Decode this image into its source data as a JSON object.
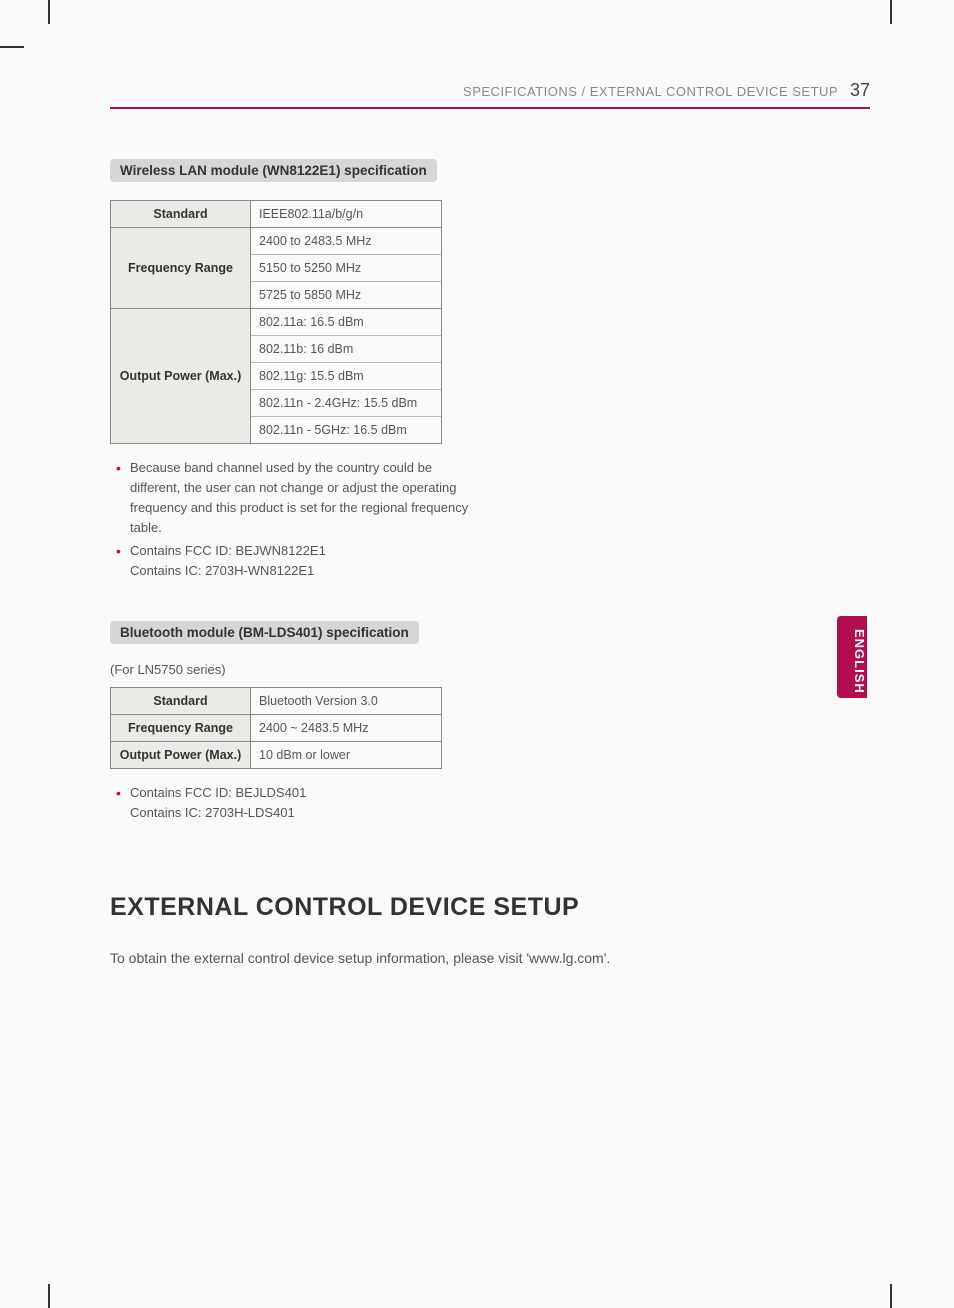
{
  "header": {
    "title": "SPECIFICATIONS / EXTERNAL CONTROL DEVICE SETUP",
    "page_number": "37"
  },
  "lang_tab": "ENGLISH",
  "wifi": {
    "badge": "Wireless LAN module (WN8122E1) specification",
    "rows": [
      {
        "label": "Standard",
        "values": [
          "IEEE802.11a/b/g/n"
        ]
      },
      {
        "label": "Frequency Range",
        "values": [
          "2400 to 2483.5 MHz",
          "5150 to 5250 MHz",
          "5725 to 5850 MHz"
        ]
      },
      {
        "label": "Output Power (Max.)",
        "values": [
          "802.11a: 16.5 dBm",
          "802.11b: 16 dBm",
          "802.11g: 15.5 dBm",
          "802.11n - 2.4GHz: 15.5 dBm",
          "802.11n - 5GHz: 16.5 dBm"
        ]
      }
    ],
    "notes": [
      "Because band channel used by the country could be different, the user can not change or adjust the operating frequency and this product is set for the regional frequency table.",
      "Contains FCC ID: BEJWN8122E1\nContains IC: 2703H-WN8122E1"
    ]
  },
  "bt": {
    "badge": "Bluetooth module (BM-LDS401) specification",
    "subnote": "(For LN5750 series)",
    "rows": [
      {
        "label": "Standard",
        "values": [
          "Bluetooth Version 3.0"
        ]
      },
      {
        "label": "Frequency Range",
        "values": [
          "2400 ~ 2483.5 MHz"
        ]
      },
      {
        "label": "Output Power (Max.)",
        "values": [
          "10 dBm or lower"
        ]
      }
    ],
    "notes": [
      "Contains FCC ID: BEJLDS401\nContains IC: 2703H-LDS401"
    ]
  },
  "ext": {
    "heading": "EXTERNAL CONTROL DEVICE SETUP",
    "body": "To obtain the external control device setup information, please visit 'www.lg.com'."
  }
}
